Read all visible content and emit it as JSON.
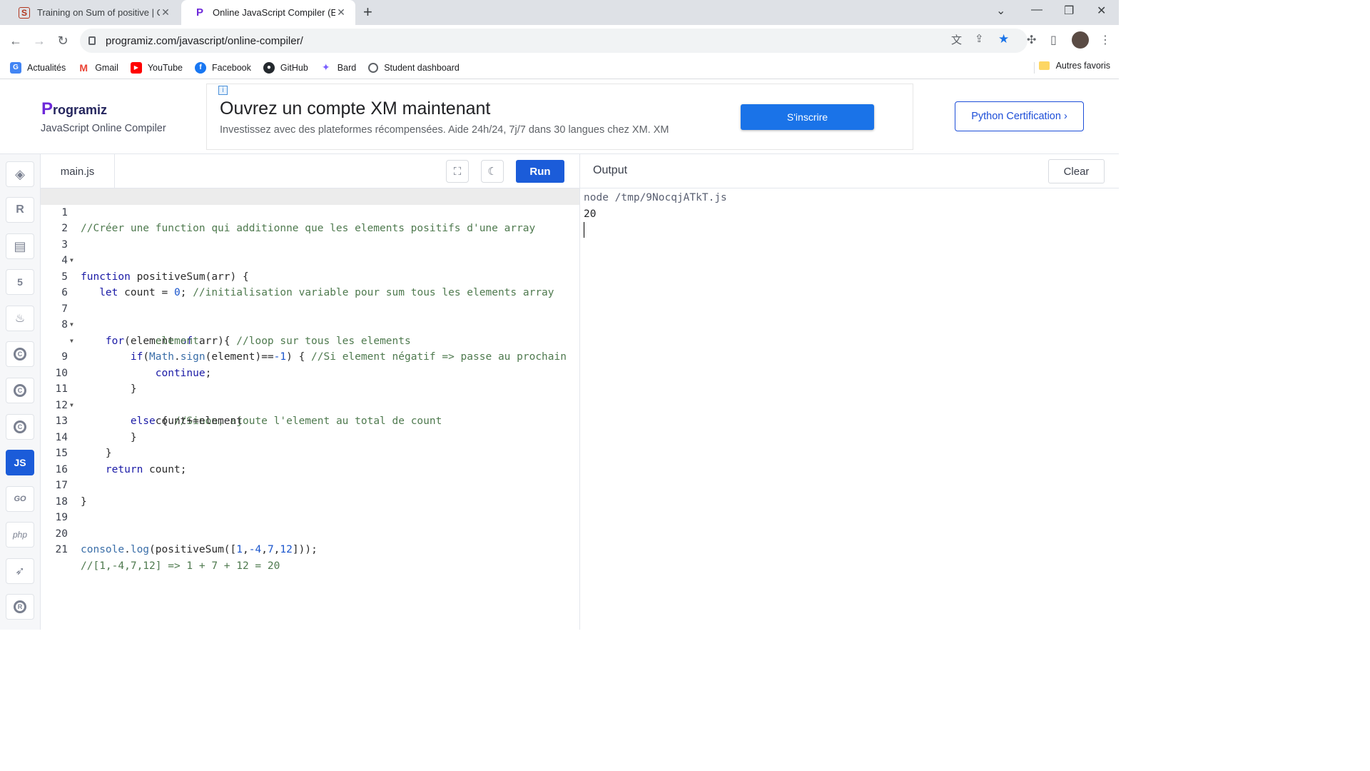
{
  "browser": {
    "tabs": [
      {
        "title": "Training on Sum of positive | Cod",
        "favicon": "codewars-icon"
      },
      {
        "title": "Online JavaScript Compiler (Edito",
        "favicon": "programiz-icon"
      }
    ],
    "url": "programiz.com/javascript/online-compiler/",
    "bookmarks": [
      {
        "label": "Actualités",
        "icon": "google-news-icon"
      },
      {
        "label": "Gmail",
        "icon": "gmail-icon"
      },
      {
        "label": "YouTube",
        "icon": "youtube-icon"
      },
      {
        "label": "Facebook",
        "icon": "facebook-icon"
      },
      {
        "label": "GitHub",
        "icon": "github-icon"
      },
      {
        "label": "Bard",
        "icon": "bard-icon"
      },
      {
        "label": "Student dashboard",
        "icon": "globe-icon"
      }
    ],
    "other_bookmarks": "Autres favoris"
  },
  "header": {
    "logo": "rogramiz",
    "logo_initial": "P",
    "subtitle": "JavaScript Online Compiler",
    "ad": {
      "info": "i",
      "title": "Ouvrez un compte XM maintenant",
      "text": "Investissez avec des plateformes récompensées. Aide 24h/24, 7j/7 dans 30 langues chez XM. XM",
      "button": "S'inscrire"
    },
    "cert_button": "Python Certification ›"
  },
  "sidebar": {
    "languages": [
      "python",
      "r",
      "sql",
      "html",
      "java",
      "c",
      "cpp",
      "csharp",
      "js",
      "go",
      "php",
      "swift",
      "rust"
    ],
    "active": "js",
    "js_label": "JS",
    "go_label": "GO",
    "php_label": "php"
  },
  "editor": {
    "file_name": "main.js",
    "run_label": "Run",
    "lines": [
      "//Créer une function qui additionne que les elements positifs d'une array",
      "",
      "function positiveSum(arr) {",
      "",
      "   let count = 0; //initialisation variable pour sum tous les elements array",
      "",
      "    for(element of arr){ //loop sur tous les elements",
      "        if(Math.sign(element)==-1) { //Si element négatif => passe au prochain",
      "            element",
      "            continue;",
      "        }",
      "        else { //Sinon, ajoute l'element au total de count",
      "            count+=element",
      "        }",
      "    }",
      "    return count;",
      "",
      "}",
      "",
      "",
      "console.log(positiveSum([1,-4,7,12]));",
      "//[1,-4,7,12] => 1 + 7 + 12 = 20"
    ]
  },
  "output": {
    "title": "Output",
    "clear_label": "Clear",
    "command": "node /tmp/9NocqjATkT.js",
    "result": "20"
  }
}
